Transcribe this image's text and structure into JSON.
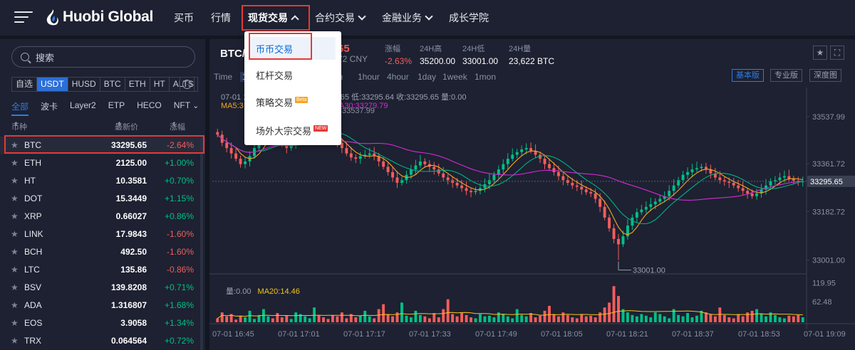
{
  "header": {
    "logo_text": "Huobi Global",
    "nav": [
      {
        "label": "买币",
        "chevron": "none"
      },
      {
        "label": "行情",
        "chevron": "none"
      },
      {
        "label": "现货交易",
        "chevron": "up",
        "active": true
      },
      {
        "label": "合约交易",
        "chevron": "down"
      },
      {
        "label": "金融业务",
        "chevron": "down"
      },
      {
        "label": "成长学院",
        "chevron": "none"
      }
    ]
  },
  "dropdown": {
    "items": [
      {
        "label": "币币交易",
        "selected": true,
        "tag": ""
      },
      {
        "label": "杠杆交易",
        "tag": ""
      },
      {
        "label": "策略交易",
        "tag": "Beta"
      },
      {
        "label": "场外大宗交易",
        "tag": "NEW"
      }
    ]
  },
  "sidebar": {
    "search_placeholder": "搜索",
    "quote_tabs": [
      "自选",
      "USDT",
      "HUSD",
      "BTC",
      "ETH",
      "HT",
      "ALTS"
    ],
    "active_quote": "USDT",
    "filter_tabs": [
      "全部",
      "波卡",
      "Layer2",
      "ETP",
      "HECO",
      "NFT"
    ],
    "columns": {
      "pair": "币种",
      "price": "最新价",
      "change": "涨幅"
    },
    "rows": [
      {
        "sym": "BTC",
        "price": "33295.65",
        "chg": "-2.64%",
        "dir": "down",
        "selected": true
      },
      {
        "sym": "ETH",
        "price": "2125.00",
        "chg": "+1.00%",
        "dir": "up"
      },
      {
        "sym": "HT",
        "price": "10.3581",
        "chg": "+0.70%",
        "dir": "up"
      },
      {
        "sym": "DOT",
        "price": "15.3449",
        "chg": "+1.15%",
        "dir": "up"
      },
      {
        "sym": "XRP",
        "price": "0.66027",
        "chg": "+0.86%",
        "dir": "up"
      },
      {
        "sym": "LINK",
        "price": "17.9843",
        "chg": "-1.60%",
        "dir": "down"
      },
      {
        "sym": "BCH",
        "price": "492.50",
        "chg": "-1.60%",
        "dir": "down"
      },
      {
        "sym": "LTC",
        "price": "135.86",
        "chg": "-0.86%",
        "dir": "down"
      },
      {
        "sym": "BSV",
        "price": "139.8208",
        "chg": "+0.71%",
        "dir": "up"
      },
      {
        "sym": "ADA",
        "price": "1.316807",
        "chg": "+1.68%",
        "dir": "up"
      },
      {
        "sym": "EOS",
        "price": "3.9058",
        "chg": "+1.34%",
        "dir": "up"
      },
      {
        "sym": "TRX",
        "price": "0.064564",
        "chg": "+0.72%",
        "dir": "up"
      }
    ]
  },
  "ticker": {
    "symbol": "BTC/",
    "price": "65",
    "cny": "72 CNY",
    "stats": [
      {
        "label": "涨幅",
        "value": "-2.63%",
        "dir": "down"
      },
      {
        "label": "24H高",
        "value": "35200.00"
      },
      {
        "label": "24H低",
        "value": "33001.00"
      },
      {
        "label": "24H量",
        "value": "23,622 BTC"
      }
    ]
  },
  "intervals": {
    "items": [
      "Time",
      "1",
      "in",
      "1hour",
      "4hour",
      "1day",
      "1week",
      "1mon"
    ],
    "active": "1"
  },
  "view_buttons": [
    {
      "label": "基本版",
      "active": true
    },
    {
      "label": "专业版"
    },
    {
      "label": "深度图"
    }
  ],
  "legend": {
    "ohlc": "07-01 1",
    "ohlc_tail": "295.65 低:33295.64 收:33295.65 量:0.00",
    "ma5": "MA5:3",
    "ma30": "MA30:33279.79",
    "vol": "量:0.00",
    "ma20": "MA20:14.46",
    "ghost": "33537.99"
  },
  "colors": {
    "up": "#00c087",
    "down": "#f55d5b",
    "ma5": "#f5a623",
    "ma10": "#00b386",
    "ma30": "#d62ad6",
    "accent": "#2b7ce6"
  },
  "chart_data": {
    "type": "candlestick",
    "y_ticks": [
      "33537.99",
      "33361.72",
      "33182.72",
      "33001.00"
    ],
    "y_range": [
      32960,
      33620
    ],
    "current_price": "33295.65",
    "min_label": "33001.00",
    "x_ticks": [
      "07-01 16:45",
      "07-01 17:01",
      "07-01 17:17",
      "07-01 17:33",
      "07-01 17:49",
      "07-01 18:05",
      "07-01 18:21",
      "07-01 18:37",
      "07-01 18:53",
      "07-01 19:09"
    ],
    "vol_ticks": [
      "119.95",
      "62.48"
    ],
    "vol_max": 130,
    "close": [
      33470,
      33440,
      33420,
      33400,
      33380,
      33360,
      33370,
      33390,
      33420,
      33450,
      33470,
      33500,
      33480,
      33460,
      33440,
      33420,
      33430,
      33450,
      33470,
      33490,
      33500,
      33515,
      33500,
      33480,
      33470,
      33455,
      33440,
      33420,
      33400,
      33385,
      33380,
      33390,
      33395,
      33400,
      33390,
      33370,
      33350,
      33330,
      33310,
      33290,
      33300,
      33320,
      33340,
      33355,
      33370,
      33360,
      33350,
      33340,
      33325,
      33310,
      33300,
      33290,
      33280,
      33270,
      33260,
      33255,
      33260,
      33270,
      33285,
      33300,
      33320,
      33340,
      33360,
      33380,
      33395,
      33405,
      33415,
      33420,
      33410,
      33395,
      33380,
      33360,
      33345,
      33330,
      33315,
      33300,
      33290,
      33280,
      33275,
      33265,
      33255,
      33250,
      33230,
      33200,
      33160,
      33120,
      33080,
      33060,
      33090,
      33130,
      33160,
      33180,
      33190,
      33200,
      33210,
      33220,
      33230,
      33240,
      33260,
      33280,
      33300,
      33320,
      33330,
      33340,
      33345,
      33350,
      33340,
      33325,
      33310,
      33300,
      33295,
      33290,
      33280,
      33270,
      33260,
      33250,
      33240,
      33250,
      33265,
      33280,
      33295,
      33300,
      33310,
      33315,
      33305,
      33298,
      33295,
      33295
    ],
    "volume": [
      12,
      30,
      18,
      25,
      8,
      20,
      15,
      35,
      10,
      22,
      40,
      18,
      12,
      28,
      15,
      20,
      10,
      30,
      25,
      18,
      12,
      45,
      20,
      15,
      10,
      22,
      18,
      30,
      12,
      25,
      15,
      20,
      35,
      18,
      12,
      40,
      55,
      25,
      18,
      30,
      60,
      20,
      15,
      35,
      22,
      18,
      12,
      28,
      15,
      40,
      70,
      25,
      18,
      30,
      22,
      15,
      12,
      25,
      18,
      20,
      15,
      30,
      25,
      18,
      12,
      40,
      22,
      18,
      28,
      15,
      20,
      35,
      50,
      25,
      18,
      30,
      22,
      15,
      12,
      25,
      18,
      20,
      15,
      30,
      45,
      60,
      110,
      80,
      40,
      30,
      22,
      18,
      25,
      20,
      15,
      30,
      25,
      18,
      12,
      40,
      22,
      18,
      28,
      15,
      20,
      35,
      30,
      25,
      18,
      45,
      22,
      15,
      12,
      25,
      18,
      30,
      35,
      40,
      25,
      18,
      30,
      22,
      15,
      12,
      20,
      18,
      22,
      15
    ]
  }
}
